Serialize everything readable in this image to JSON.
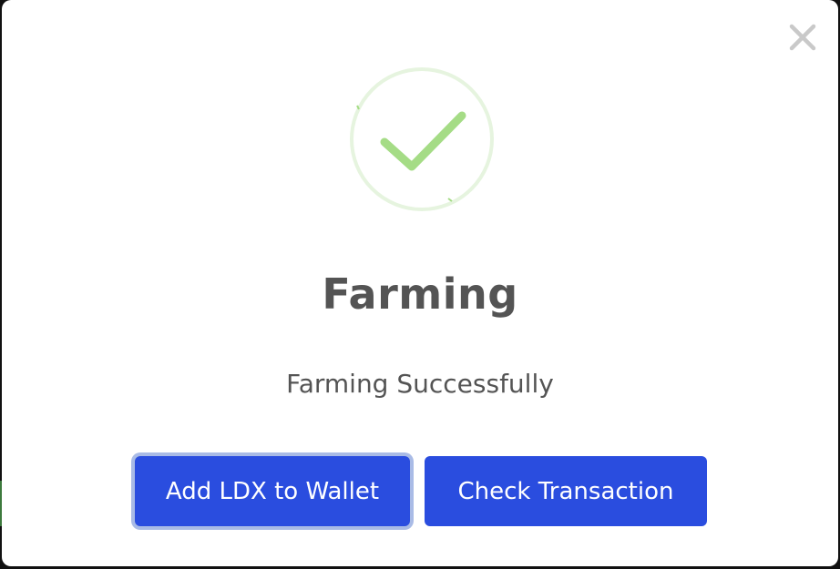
{
  "modal": {
    "title": "Farming",
    "message": "Farming Successfully",
    "close_icon": "close-icon",
    "status_icon": "success-check-icon",
    "accent_color": "#2a4ddf",
    "success_color": "#a5dc86",
    "buttons": {
      "add_wallet_label": "Add LDX to Wallet",
      "check_tx_label": "Check Transaction"
    }
  }
}
